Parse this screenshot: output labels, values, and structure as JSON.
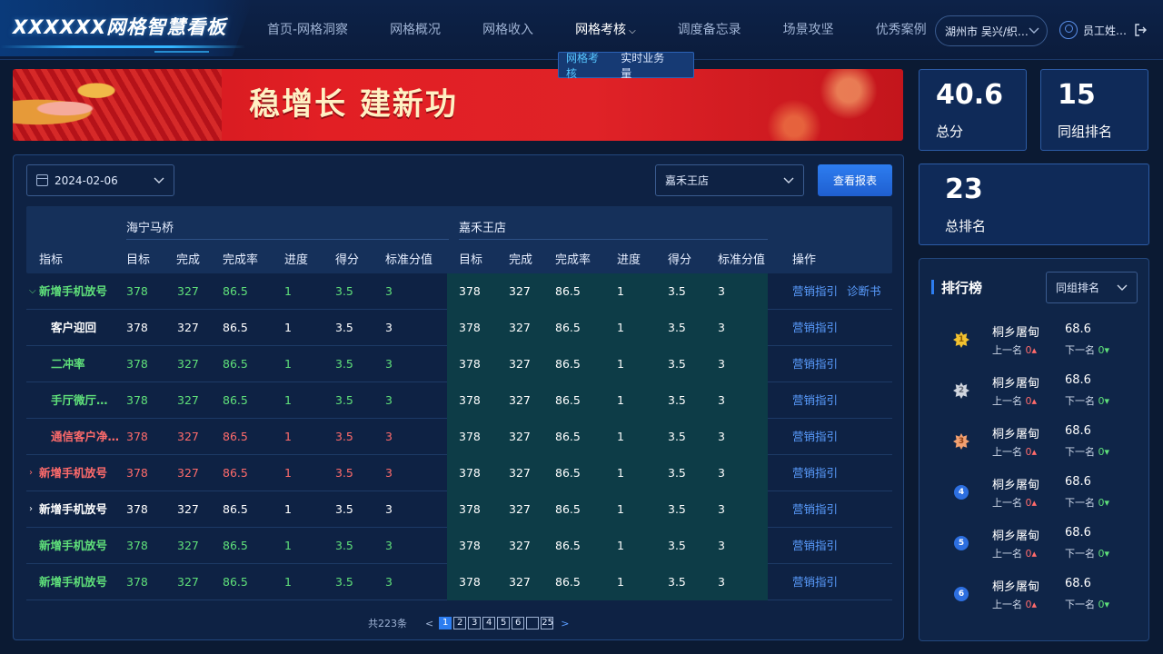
{
  "header": {
    "logo": "XXXXXX网格智慧看板",
    "nav": [
      {
        "label": "首页-网格洞察"
      },
      {
        "label": "网格概况"
      },
      {
        "label": "网格收入"
      },
      {
        "label": "网格考核",
        "active": true
      },
      {
        "label": "调度备忘录"
      },
      {
        "label": "场景攻坚"
      },
      {
        "label": "优秀案例"
      }
    ],
    "nav_chevron": "⌵",
    "dropdown": [
      "网格考核",
      "实时业务量"
    ],
    "city": "湖州市 吴兴/织…",
    "user": "员工姓…"
  },
  "banner": {
    "text": "稳增长 建新功"
  },
  "filters": {
    "date": "2024-02-06",
    "store": "嘉禾王店",
    "report_button": "查看报表"
  },
  "table": {
    "col_indicator": "指标",
    "col_action": "操作",
    "groups": [
      "海宁马桥",
      "嘉禾王店"
    ],
    "metrics": [
      "目标",
      "完成",
      "完成率",
      "进度",
      "得分",
      "标准分值"
    ],
    "rows": [
      {
        "name": "新增手机放号",
        "arrow": "⌵",
        "color": "green",
        "values": [
          "378",
          "327",
          "86.5",
          "1",
          "3.5",
          "3"
        ],
        "values2": [
          "378",
          "327",
          "86.5",
          "1",
          "3.5",
          "3"
        ],
        "actions": [
          "营销指引",
          "诊断书"
        ]
      },
      {
        "name": "客户迎回",
        "arrow": "",
        "color": "white",
        "sub": true,
        "values": [
          "378",
          "327",
          "86.5",
          "1",
          "3.5",
          "3"
        ],
        "values2": [
          "378",
          "327",
          "86.5",
          "1",
          "3.5",
          "3"
        ],
        "actions": [
          "营销指引"
        ]
      },
      {
        "name": "二冲率",
        "arrow": "",
        "color": "green",
        "sub": true,
        "values": [
          "378",
          "327",
          "86.5",
          "1",
          "3.5",
          "3"
        ],
        "values2": [
          "378",
          "327",
          "86.5",
          "1",
          "3.5",
          "3"
        ],
        "actions": [
          "营销指引"
        ]
      },
      {
        "name": "手厅微厅…",
        "arrow": "",
        "color": "green",
        "sub": true,
        "values": [
          "378",
          "327",
          "86.5",
          "1",
          "3.5",
          "3"
        ],
        "values2": [
          "378",
          "327",
          "86.5",
          "1",
          "3.5",
          "3"
        ],
        "actions": [
          "营销指引"
        ]
      },
      {
        "name": "通信客户净…",
        "arrow": "",
        "color": "red",
        "sub": true,
        "values": [
          "378",
          "327",
          "86.5",
          "1",
          "3.5",
          "3"
        ],
        "values2": [
          "378",
          "327",
          "86.5",
          "1",
          "3.5",
          "3"
        ],
        "actions": [
          "营销指引"
        ]
      },
      {
        "name": "新增手机放号",
        "arrow": "›",
        "color": "red",
        "values": [
          "378",
          "327",
          "86.5",
          "1",
          "3.5",
          "3"
        ],
        "values2": [
          "378",
          "327",
          "86.5",
          "1",
          "3.5",
          "3"
        ],
        "actions": [
          "营销指引"
        ]
      },
      {
        "name": "新增手机放号",
        "arrow": "›",
        "color": "white",
        "values": [
          "378",
          "327",
          "86.5",
          "1",
          "3.5",
          "3"
        ],
        "values2": [
          "378",
          "327",
          "86.5",
          "1",
          "3.5",
          "3"
        ],
        "actions": [
          "营销指引"
        ]
      },
      {
        "name": "新增手机放号",
        "arrow": "",
        "color": "green",
        "values": [
          "378",
          "327",
          "86.5",
          "1",
          "3.5",
          "3"
        ],
        "values2": [
          "378",
          "327",
          "86.5",
          "1",
          "3.5",
          "3"
        ],
        "actions": [
          "营销指引"
        ]
      },
      {
        "name": "新增手机放号",
        "arrow": "",
        "color": "green",
        "values": [
          "378",
          "327",
          "86.5",
          "1",
          "3.5",
          "3"
        ],
        "values2": [
          "378",
          "327",
          "86.5",
          "1",
          "3.5",
          "3"
        ],
        "actions": [
          "营销指引"
        ]
      }
    ],
    "pager": {
      "total": "共223条",
      "prev": "<",
      "next": ">",
      "pages": [
        "1",
        "2",
        "3",
        "4",
        "5",
        "6",
        "",
        "25"
      ],
      "current": "1"
    }
  },
  "stats": [
    {
      "value": "40.6",
      "label": "总分"
    },
    {
      "value": "15",
      "label": "同组排名"
    },
    {
      "value": "23",
      "label": "总排名"
    }
  ],
  "ranking": {
    "title": "排行榜",
    "select": "同组排名",
    "up_label": "上一名",
    "down_label": "下一名",
    "up_arrow": "▴",
    "down_arrow": "▾",
    "items": [
      {
        "rank": "1",
        "name": "桐乡屠甸",
        "score": "68.6",
        "up": "0",
        "down": "0",
        "badge": "gold"
      },
      {
        "rank": "2",
        "name": "桐乡屠甸",
        "score": "68.6",
        "up": "0",
        "down": "0",
        "badge": "silver"
      },
      {
        "rank": "3",
        "name": "桐乡屠甸",
        "score": "68.6",
        "up": "0",
        "down": "0",
        "badge": "bronze"
      },
      {
        "rank": "4",
        "name": "桐乡屠甸",
        "score": "68.6",
        "up": "0",
        "down": "0",
        "badge": "circle"
      },
      {
        "rank": "5",
        "name": "桐乡屠甸",
        "score": "68.6",
        "up": "0",
        "down": "0",
        "badge": "circle"
      },
      {
        "rank": "6",
        "name": "桐乡屠甸",
        "score": "68.6",
        "up": "0",
        "down": "0",
        "badge": "circle"
      }
    ]
  },
  "colors": {
    "accent": "#2d7df0",
    "green": "#5fe07a",
    "red": "#ff6b6b",
    "link": "#5a9dff"
  },
  "icons": {
    "calendar": "calendar-icon",
    "user": "user-icon",
    "logout": "logout-icon",
    "chevron": "chevron-down-icon"
  }
}
